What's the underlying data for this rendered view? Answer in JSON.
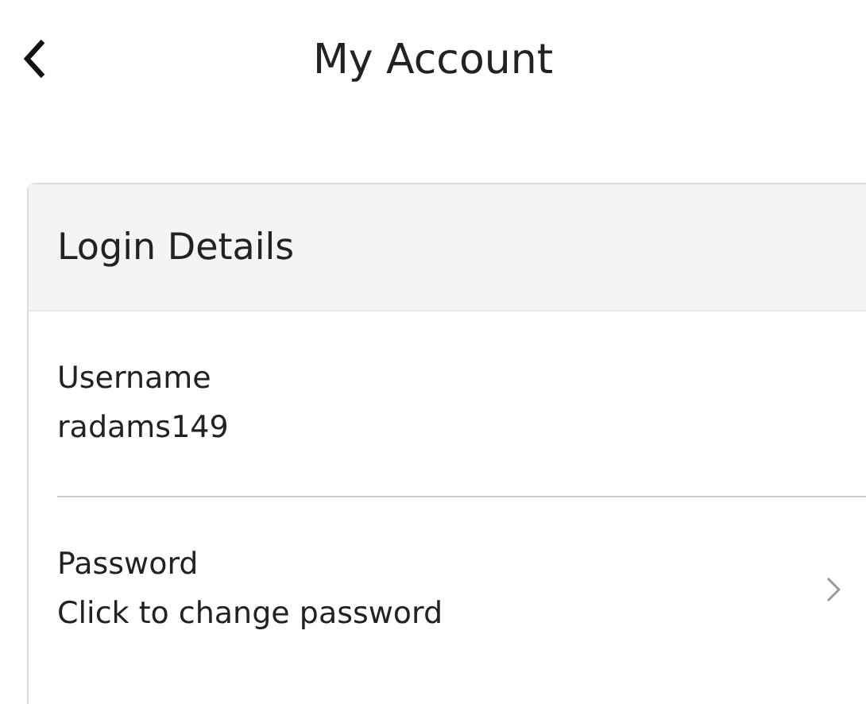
{
  "header": {
    "title": "My Account"
  },
  "section": {
    "title": "Login Details",
    "rows": [
      {
        "kind": "info",
        "label": "Username",
        "value": "radams149"
      },
      {
        "kind": "link",
        "label": "Password",
        "value": "Click to change password"
      }
    ]
  }
}
